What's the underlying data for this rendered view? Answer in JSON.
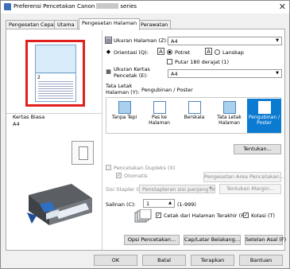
{
  "window": {
    "title_prefix": "Preferensi Pencetakan Canon",
    "title_suffix": "series",
    "close_glyph": "✕"
  },
  "tabs": [
    {
      "label": "Pengesetan Cepat"
    },
    {
      "label": "Utama"
    },
    {
      "label": "Pengesetan Halaman"
    },
    {
      "label": "Perawatan"
    }
  ],
  "preview": {
    "page_number": "2"
  },
  "media": {
    "label": "Kertas Biasa",
    "value": "A4"
  },
  "page_size": {
    "label": "Ukuran Halaman (Z):",
    "value": "A4"
  },
  "orientation": {
    "label": "Orientasi (Q):",
    "portrait": "Potret",
    "landscape": "Lanskap",
    "rotate": "Putar 180 derajat (1)"
  },
  "printer_paper": {
    "label_line1": "Ukuran Kertas",
    "label_line2": "Pencetak (E):",
    "value": "A4"
  },
  "layout": {
    "label_line1": "Tata Letak",
    "label_line2": "Halaman (Y):",
    "current": "Pengubinan / Poster",
    "options": [
      {
        "label": "Tanpa Tepi"
      },
      {
        "label": "Pas ke Halaman"
      },
      {
        "label": "Berskala"
      },
      {
        "label": "Tata Letak Halaman"
      },
      {
        "label": "Pengubinan / Poster"
      }
    ],
    "specify_button": "Tentukan..."
  },
  "duplex": {
    "label": "Pencetakan Dupleks (X)",
    "auto": "Otomatis",
    "area_button": "Pengesetan Area Pencetakan..."
  },
  "staple": {
    "label": "Sisi Stapler (I):",
    "value": "Penstapleran sisi panjang (Kiri)",
    "margin_button": "Tentukan Margin..."
  },
  "copies": {
    "label": "Salinan (C):",
    "value": "1",
    "range": "(1-999)",
    "last_page_first": "Cetak dari Halaman Terakhir (R)",
    "collate": "Kolasi (T)"
  },
  "action_buttons": {
    "print_options": "Opsi Pencetakan...",
    "stamp": "Cap/Latar Belakang...",
    "defaults": "Setelan Asal (F)"
  },
  "footer": {
    "ok": "OK",
    "cancel": "Batal",
    "apply": "Terapkan",
    "help": "Bantuan"
  }
}
